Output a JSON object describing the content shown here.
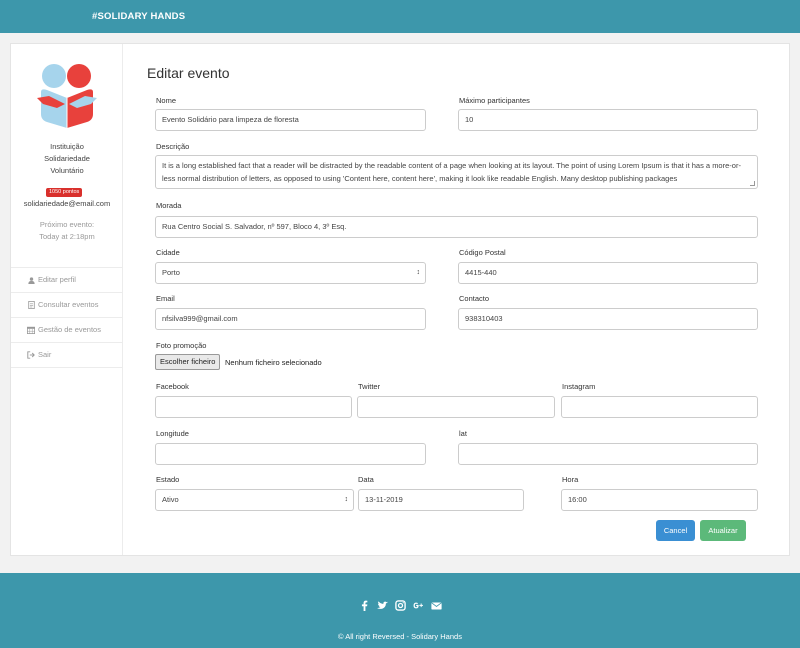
{
  "navbar": {
    "brand": "#SOLIDARY HANDS"
  },
  "sidebar": {
    "type_lines": [
      "Instituição",
      "Solidariedade",
      "Voluntário"
    ],
    "points": "1050 pontos",
    "email": "solidariedade@email.com",
    "next_event_label": "Próximo evento:",
    "next_event_time": "Today at 2:18pm",
    "menu": [
      {
        "label": "Editar perfil",
        "icon": "user-icon"
      },
      {
        "label": "Consultar eventos",
        "icon": "document-icon"
      },
      {
        "label": "Gestão de eventos",
        "icon": "calendar-icon"
      },
      {
        "label": "Sair",
        "icon": "sign-out-icon"
      }
    ]
  },
  "form": {
    "title": "Editar evento",
    "nome": {
      "label": "Nome",
      "value": "Evento Solidário para limpeza de floresta"
    },
    "max_participantes": {
      "label": "Máximo participantes",
      "value": "10"
    },
    "descricao": {
      "label": "Descrição",
      "value": "It is a long established fact that a reader will be distracted by the readable content of a page when looking at its layout. The point of using Lorem Ipsum is that it has a more-or-less normal distribution of letters, as opposed to using 'Content here, content here', making it look like readable English. Many desktop publishing packages"
    },
    "morada": {
      "label": "Morada",
      "value": "Rua Centro Social S. Salvador, nº 597, Bloco 4, 3º Esq."
    },
    "cidade": {
      "label": "Cidade",
      "value": "Porto"
    },
    "codigo_postal": {
      "label": "Código Postal",
      "value": "4415-440"
    },
    "email": {
      "label": "Email",
      "value": "nfsilva999@gmail.com"
    },
    "contacto": {
      "label": "Contacto",
      "value": "938310403"
    },
    "foto": {
      "label": "Foto promoção",
      "button": "Escolher ficheiro",
      "status": "Nenhum ficheiro selecionado"
    },
    "facebook": {
      "label": "Facebook",
      "value": ""
    },
    "twitter": {
      "label": "Twitter",
      "value": ""
    },
    "instagram": {
      "label": "Instagram",
      "value": ""
    },
    "longitude": {
      "label": "Longitude",
      "value": ""
    },
    "lat": {
      "label": "lat",
      "value": ""
    },
    "estado": {
      "label": "Estado",
      "value": "Ativo"
    },
    "data": {
      "label": "Data",
      "value": "13-11-2019"
    },
    "hora": {
      "label": "Hora",
      "value": "16:00"
    },
    "cancel_label": "Cancel",
    "update_label": "Atualizar"
  },
  "footer": {
    "icons": [
      "facebook-icon",
      "twitter-icon",
      "instagram-icon",
      "google-plus-icon",
      "envelope-icon"
    ],
    "copyright": "© All right Reversed - Solidary Hands"
  },
  "colors": {
    "primary": "#3d97ab",
    "cancel": "#3a8fd3",
    "update": "#5cb97a",
    "badge": "#d9302c"
  }
}
